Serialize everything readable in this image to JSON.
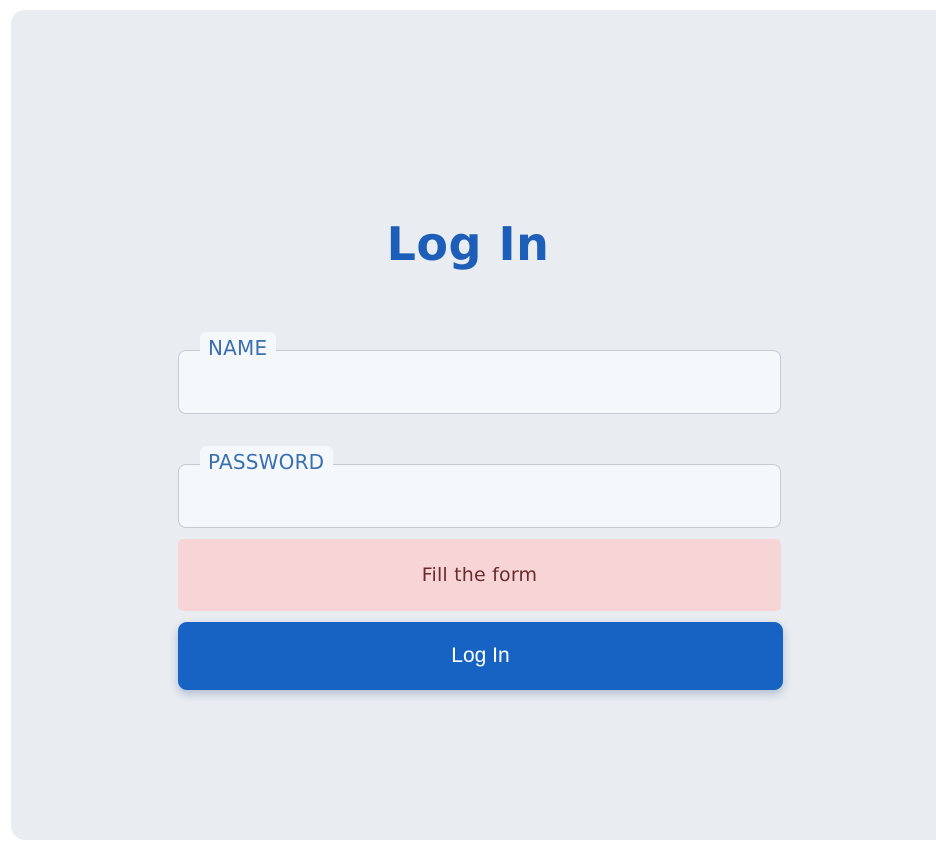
{
  "form": {
    "title": "Log In",
    "fields": [
      {
        "label": "NAME",
        "value": "",
        "placeholder": ""
      },
      {
        "label": "PASSWORD",
        "value": "",
        "placeholder": ""
      }
    ],
    "error_message": "Fill the form",
    "submit_label": "Log In"
  },
  "colors": {
    "accent": "#1763c3",
    "title": "#1d5fb8",
    "label": "#3a6fb0",
    "error_background": "#f7d5d7",
    "error_text": "#6a2a2e",
    "card_background": "#e9ecf0",
    "field_background": "#f5f8fb"
  }
}
